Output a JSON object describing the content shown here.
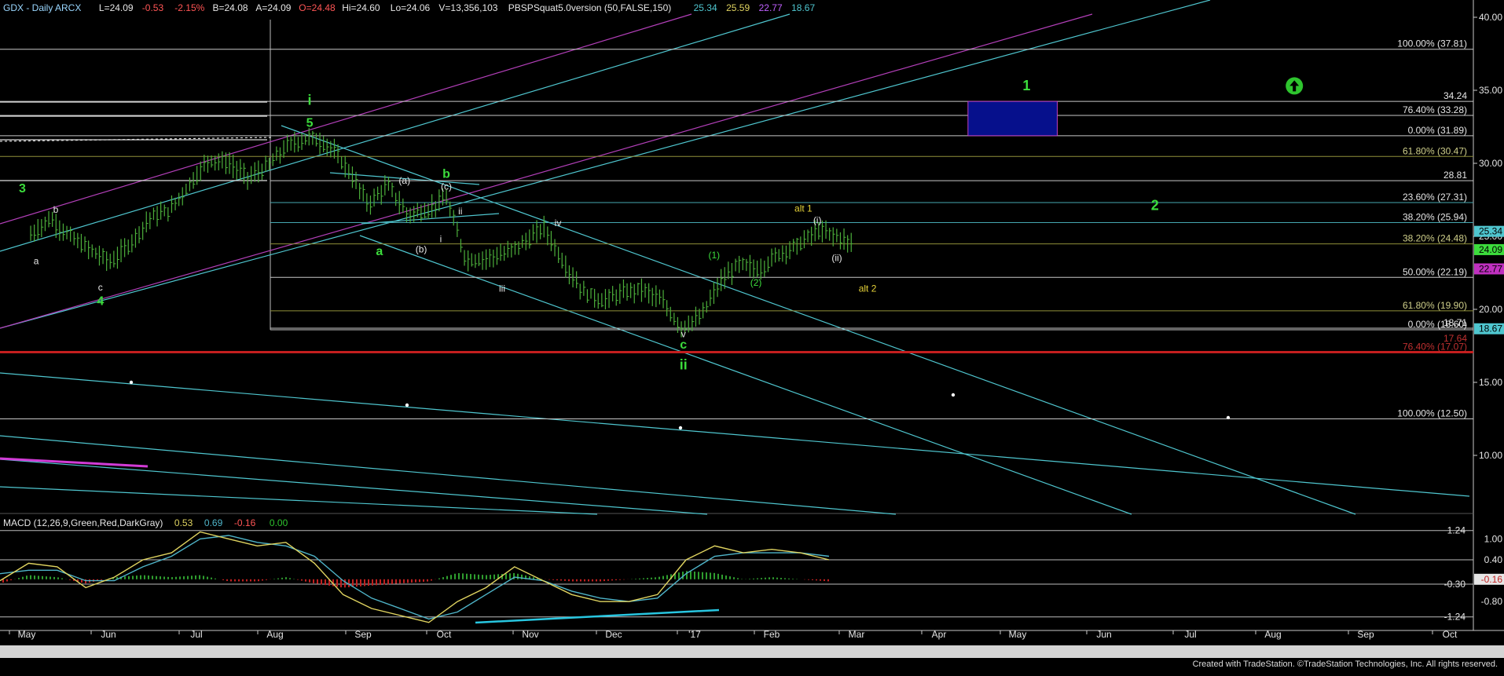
{
  "header": {
    "symbol": "GDX - Daily  ARCX",
    "last": "L=24.09",
    "change": "-0.53",
    "pct": "-2.15%",
    "bid": "B=24.08",
    "ask": "A=24.09",
    "open": "O=24.48",
    "high": "Hi=24.60",
    "low": "Lo=24.06",
    "volume": "V=13,356,103",
    "study": "PBSPSquat5.0version (50,FALSE,150)",
    "study_values": [
      "25.34",
      "25.59",
      "22.77",
      "18.67"
    ]
  },
  "macd_header": {
    "label": "MACD (12,26,9,Green,Red,DarkGray)",
    "values": [
      "0.53",
      "0.69",
      "-0.16",
      "0.00"
    ]
  },
  "footer": {
    "credit": "Created with TradeStation. ©TradeStation Technologies, Inc. All rights reserved."
  },
  "colors": {
    "background": "#000000",
    "price_bar": "#4caf3b",
    "wave_green": "#3cdc3c",
    "alt_yellow": "#e6d238",
    "cyan": "#4fc6cf",
    "magenta": "#b23fb8",
    "red_line": "#c41e1e",
    "navy_box": "#06108c",
    "macd_fast": "#e0d460",
    "macd_slow": "#4fb5c9",
    "macd_hist_pos": "#2f9e2f",
    "macd_hist_neg": "#c02020",
    "axis_text": "#e6e6e6"
  },
  "chart_data": [
    {
      "type": "line",
      "title": "GDX - Daily ARCX",
      "subtype": "ohlc-bars",
      "x_months": [
        "May",
        "Jun",
        "Jul",
        "Aug",
        "Sep",
        "Oct",
        "Nov",
        "Dec",
        "'17",
        "Feb",
        "Mar",
        "Apr",
        "May",
        "Jun",
        "Jul",
        "Aug",
        "Sep",
        "Oct"
      ],
      "y_ticks": [
        "40.00",
        "35.00",
        "30.00",
        "25.00",
        "20.00",
        "15.00",
        "10.00"
      ],
      "ylim": [
        6.5,
        41.5
      ],
      "approx_close_path": [
        {
          "x": "2016-05-02",
          "y": 25.1
        },
        {
          "x": "2016-05-09",
          "y": 26.2
        },
        {
          "x": "2016-05-16",
          "y": 25.0
        },
        {
          "x": "2016-05-23",
          "y": 24.1
        },
        {
          "x": "2016-05-31",
          "y": 23.2
        },
        {
          "x": "2016-06-07",
          "y": 24.6
        },
        {
          "x": "2016-06-14",
          "y": 26.3
        },
        {
          "x": "2016-06-21",
          "y": 26.8
        },
        {
          "x": "2016-06-28",
          "y": 28.6
        },
        {
          "x": "2016-07-05",
          "y": 30.3
        },
        {
          "x": "2016-07-12",
          "y": 30.0
        },
        {
          "x": "2016-07-19",
          "y": 29.0
        },
        {
          "x": "2016-07-26",
          "y": 29.8
        },
        {
          "x": "2016-08-02",
          "y": 31.2
        },
        {
          "x": "2016-08-10",
          "y": 31.8
        },
        {
          "x": "2016-08-17",
          "y": 31.2
        },
        {
          "x": "2016-08-24",
          "y": 29.5
        },
        {
          "x": "2016-08-31",
          "y": 27.2
        },
        {
          "x": "2016-09-07",
          "y": 28.5
        },
        {
          "x": "2016-09-14",
          "y": 26.5
        },
        {
          "x": "2016-09-21",
          "y": 26.8
        },
        {
          "x": "2016-09-28",
          "y": 27.6
        },
        {
          "x": "2016-10-05",
          "y": 23.4
        },
        {
          "x": "2016-10-12",
          "y": 23.5
        },
        {
          "x": "2016-10-19",
          "y": 23.8
        },
        {
          "x": "2016-10-26",
          "y": 24.6
        },
        {
          "x": "2016-11-02",
          "y": 25.6
        },
        {
          "x": "2016-11-09",
          "y": 23.2
        },
        {
          "x": "2016-11-16",
          "y": 21.2
        },
        {
          "x": "2016-11-23",
          "y": 20.6
        },
        {
          "x": "2016-11-30",
          "y": 21.1
        },
        {
          "x": "2016-12-07",
          "y": 21.4
        },
        {
          "x": "2016-12-14",
          "y": 20.6
        },
        {
          "x": "2016-12-21",
          "y": 18.8
        },
        {
          "x": "2016-12-28",
          "y": 19.4
        },
        {
          "x": "2017-01-04",
          "y": 21.8
        },
        {
          "x": "2017-01-11",
          "y": 23.1
        },
        {
          "x": "2017-01-18",
          "y": 22.7
        },
        {
          "x": "2017-01-25",
          "y": 23.8
        },
        {
          "x": "2017-02-01",
          "y": 24.4
        },
        {
          "x": "2017-02-08",
          "y": 25.4
        },
        {
          "x": "2017-02-15",
          "y": 25.0
        },
        {
          "x": "2017-02-21",
          "y": 24.4
        }
      ],
      "price_tags": [
        {
          "value": 25.34,
          "label": "25.34",
          "color": "#4fc6cf"
        },
        {
          "value": 24.09,
          "label": "24.09",
          "color": "#3cdc3c"
        },
        {
          "value": 22.77,
          "label": "22.77",
          "color": "#c030c0"
        },
        {
          "value": 18.67,
          "label": "18.67",
          "color": "#4fc6cf"
        }
      ],
      "fib_levels": [
        {
          "label": "100.00% (37.81)",
          "value": 37.81
        },
        {
          "label": "34.24",
          "value": 34.24
        },
        {
          "label": "76.40% (33.28)",
          "value": 33.28
        },
        {
          "label": "0.00% (31.89)",
          "value": 31.89
        },
        {
          "label": "61.80% (30.47)",
          "value": 30.47
        },
        {
          "label": "28.81",
          "value": 28.81
        },
        {
          "label": "23.60% (27.31)",
          "value": 27.31
        },
        {
          "label": "38.20% (25.94)",
          "value": 25.94
        },
        {
          "label": "38.20% (24.48)",
          "value": 24.48
        },
        {
          "label": "50.00% (22.19)",
          "value": 22.19
        },
        {
          "label": "61.80% (19.90)",
          "value": 19.9
        },
        {
          "label": "18.71",
          "value": 18.71
        },
        {
          "label": "0.00% (18.60)",
          "value": 18.6
        },
        {
          "label": "17.64",
          "value": 17.64
        },
        {
          "label": "76.40% (17.07)",
          "value": 17.07
        },
        {
          "label": "100.00% (12.50)",
          "value": 12.5
        }
      ],
      "target_box": {
        "x_start": "2017-04-03",
        "x_end": "2017-05-05",
        "y_low": 31.89,
        "y_high": 34.24
      },
      "wave_labels": [
        {
          "text": "3",
          "x": "2016-04-29",
          "y": 28.0,
          "color": "green",
          "bold": true
        },
        {
          "text": "4",
          "x": "2016-05-27",
          "y": 20.3,
          "color": "green",
          "bold": true
        },
        {
          "text": "b",
          "x": "2016-05-11",
          "y": 26.6,
          "color": "white"
        },
        {
          "text": "a",
          "x": "2016-05-04",
          "y": 23.1,
          "color": "white"
        },
        {
          "text": "c",
          "x": "2016-05-27",
          "y": 21.3,
          "color": "white"
        },
        {
          "text": "5",
          "x": "2016-08-10",
          "y": 32.5,
          "color": "green",
          "bold": true
        },
        {
          "text": "i",
          "x": "2016-08-10",
          "y": 34.0,
          "color": "green",
          "bold": true
        },
        {
          "text": "(a)",
          "x": "2016-09-13",
          "y": 28.6,
          "color": "white"
        },
        {
          "text": "b",
          "x": "2016-09-28",
          "y": 29.0,
          "color": "green",
          "bold": true
        },
        {
          "text": "(c)",
          "x": "2016-09-28",
          "y": 28.2,
          "color": "white"
        },
        {
          "text": "ii",
          "x": "2016-10-03",
          "y": 26.5,
          "color": "white"
        },
        {
          "text": "i",
          "x": "2016-09-26",
          "y": 24.6,
          "color": "white"
        },
        {
          "text": "a",
          "x": "2016-09-04",
          "y": 23.7,
          "color": "green",
          "bold": true
        },
        {
          "text": "(b)",
          "x": "2016-09-19",
          "y": 23.9,
          "color": "white"
        },
        {
          "text": "iii",
          "x": "2016-10-18",
          "y": 21.2,
          "color": "white"
        },
        {
          "text": "iv",
          "x": "2016-11-07",
          "y": 25.7,
          "color": "white"
        },
        {
          "text": "v",
          "x": "2016-12-22",
          "y": 18.1,
          "color": "white"
        },
        {
          "text": "c",
          "x": "2016-12-22",
          "y": 17.3,
          "color": "green",
          "bold": true
        },
        {
          "text": "ii",
          "x": "2016-12-22",
          "y": 15.9,
          "color": "green",
          "bold": true
        },
        {
          "text": "(1)",
          "x": "2017-01-02",
          "y": 23.5,
          "color": "green"
        },
        {
          "text": "(2)",
          "x": "2017-01-17",
          "y": 21.6,
          "color": "green"
        },
        {
          "text": "alt 1",
          "x": "2017-02-03",
          "y": 26.7,
          "color": "yellow"
        },
        {
          "text": "(i)",
          "x": "2017-02-08",
          "y": 25.9,
          "color": "white"
        },
        {
          "text": "(ii)",
          "x": "2017-02-15",
          "y": 23.3,
          "color": "white"
        },
        {
          "text": "alt 2",
          "x": "2017-02-26",
          "y": 21.2,
          "color": "yellow"
        },
        {
          "text": "1",
          "x": "2017-04-24",
          "y": 35.0,
          "color": "green",
          "bold": true
        },
        {
          "text": "2",
          "x": "2017-06-09",
          "y": 26.8,
          "color": "green",
          "bold": true
        }
      ],
      "annotations": [
        {
          "icon": "up-arrow-circle-icon",
          "x": "2017-07-29",
          "y": 35.3
        }
      ]
    },
    {
      "type": "line",
      "title": "MACD (12,26,9,Green,Red,DarkGray)",
      "y_ticks": [
        "1.24",
        "1.00",
        "0.40",
        "-0.30",
        "-0.16",
        "-0.80",
        "-1.24"
      ],
      "ylim": [
        -1.45,
        1.55
      ],
      "level_lines": [
        1.24,
        0.4,
        -0.3,
        -1.24
      ],
      "macd_line": [
        -0.2,
        0.3,
        0.2,
        -0.4,
        -0.1,
        0.4,
        0.6,
        1.2,
        1.0,
        0.8,
        0.9,
        0.3,
        -0.6,
        -1.0,
        -1.2,
        -1.4,
        -0.8,
        -0.4,
        0.2,
        -0.2,
        -0.6,
        -0.8,
        -0.8,
        -0.6,
        0.4,
        0.8,
        0.6,
        0.7,
        0.6,
        0.4
      ],
      "signal_line": [
        0.0,
        0.1,
        0.1,
        -0.2,
        -0.2,
        0.2,
        0.5,
        1.0,
        1.1,
        0.9,
        0.8,
        0.5,
        -0.2,
        -0.7,
        -1.0,
        -1.3,
        -1.1,
        -0.6,
        -0.1,
        -0.2,
        -0.5,
        -0.7,
        -0.8,
        -0.7,
        0.0,
        0.5,
        0.6,
        0.6,
        0.6,
        0.5
      ]
    }
  ]
}
